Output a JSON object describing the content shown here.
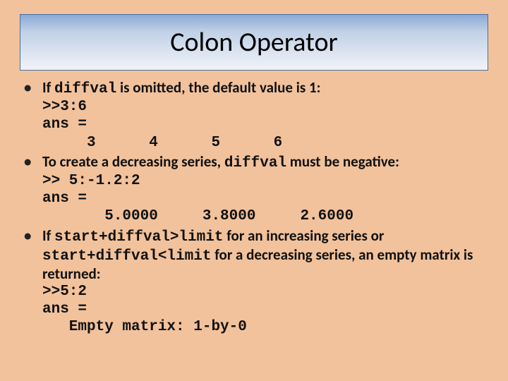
{
  "title": "Colon Operator",
  "bullets": [
    {
      "pre": "If ",
      "code1": "diffval",
      "mid": " is omitted, the default value is 1:",
      "block": ">>3:6\nans =\n     3      4      5      6"
    },
    {
      "pre": "To create a decreasing series, ",
      "code1": "diffval",
      "mid": " must be negative:",
      "block": ">> 5:-1.2:2\nans =\n       5.0000     3.8000     2.6000"
    },
    {
      "pre": "If ",
      "code1": "start+diffval>limit",
      "mid": " for an increasing series or ",
      "code2": "start+diffval<limit",
      "post": " for a decreasing series, an empty matrix is returned:",
      "block": ">>5:2\nans =\n   Empty matrix: 1-by-0"
    }
  ]
}
